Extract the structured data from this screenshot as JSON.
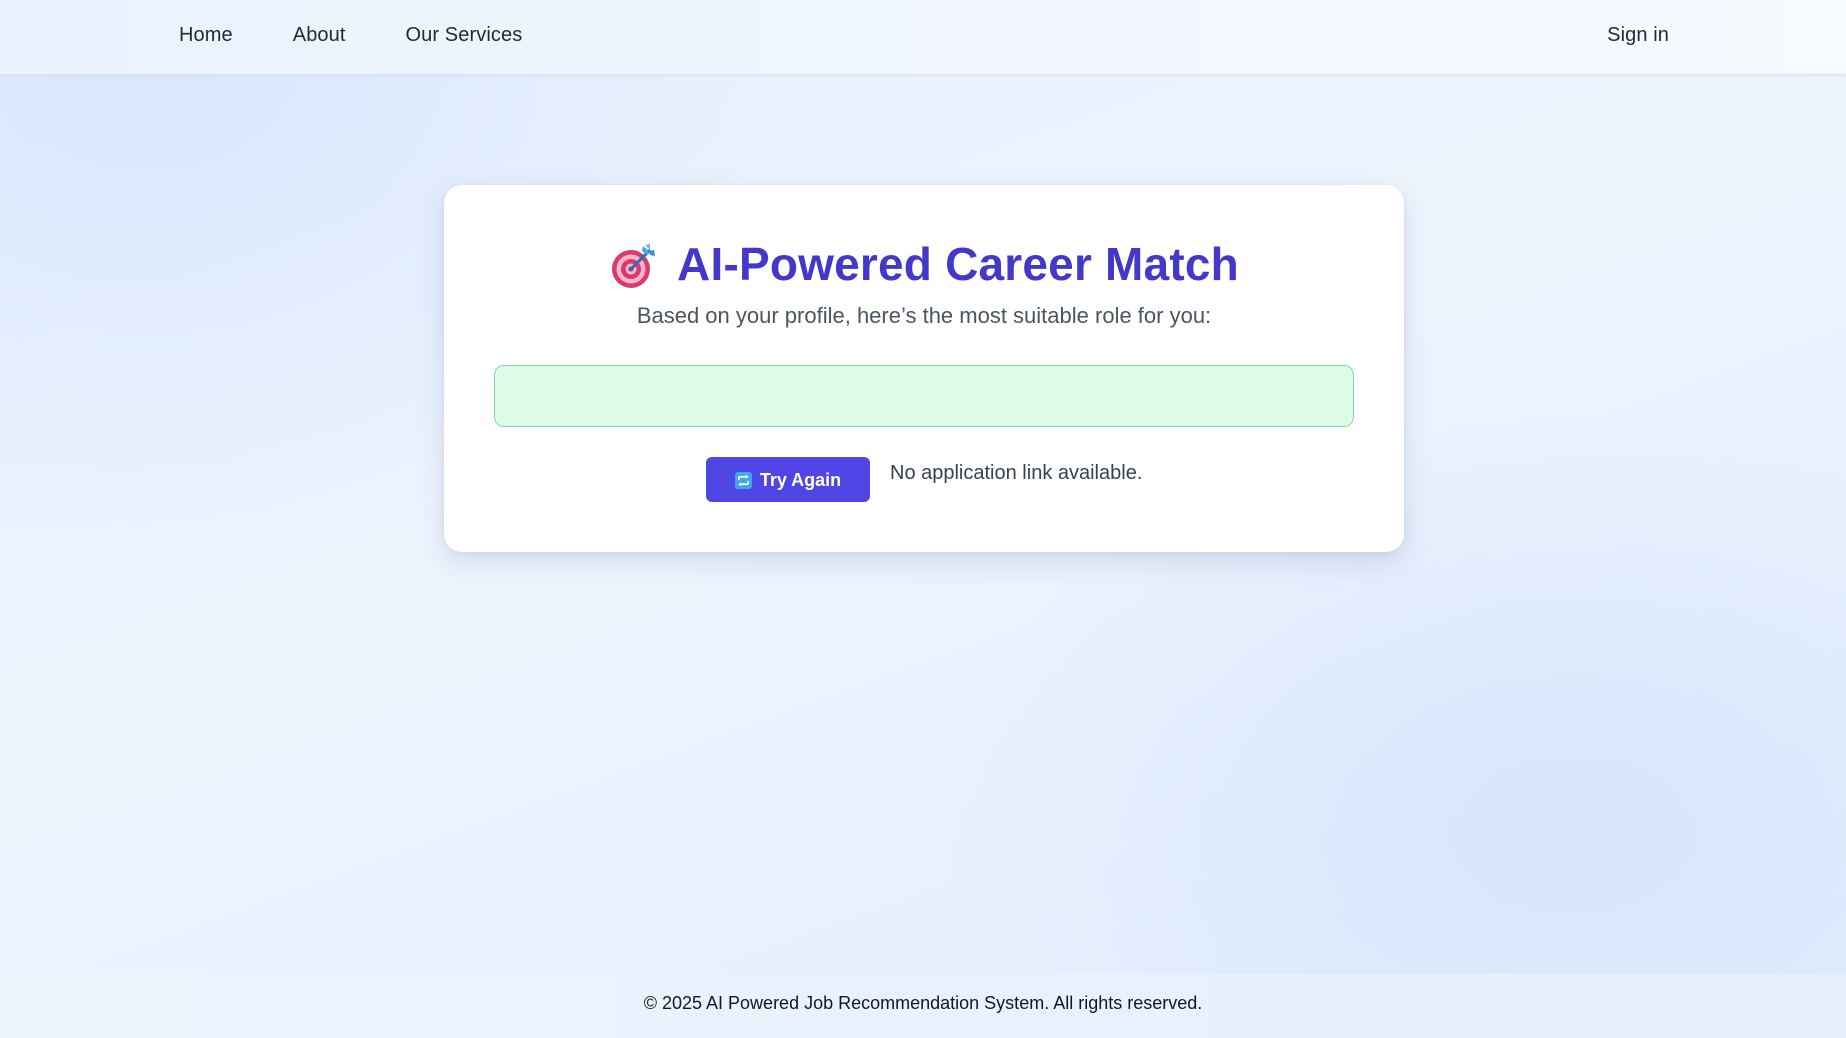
{
  "nav": {
    "links": [
      "Home",
      "About",
      "Our Services"
    ],
    "sign_in": "Sign in"
  },
  "card": {
    "icon": "direct-hit-target-icon",
    "title": "AI-Powered Career Match",
    "subtitle": "Based on your profile, here’s the most suitable role for you:",
    "result_value": "",
    "try_again_icon": "repeat-icon",
    "try_again_label": "Try Again",
    "no_link_text": "No application link available."
  },
  "footer": {
    "text": "© 2025 AI Powered Job Recommendation System. All rights reserved."
  },
  "colors": {
    "title": "#4338ca",
    "button": "#4f46e5",
    "result_bg": "#dcfce7",
    "result_border": "#86d8a0"
  }
}
